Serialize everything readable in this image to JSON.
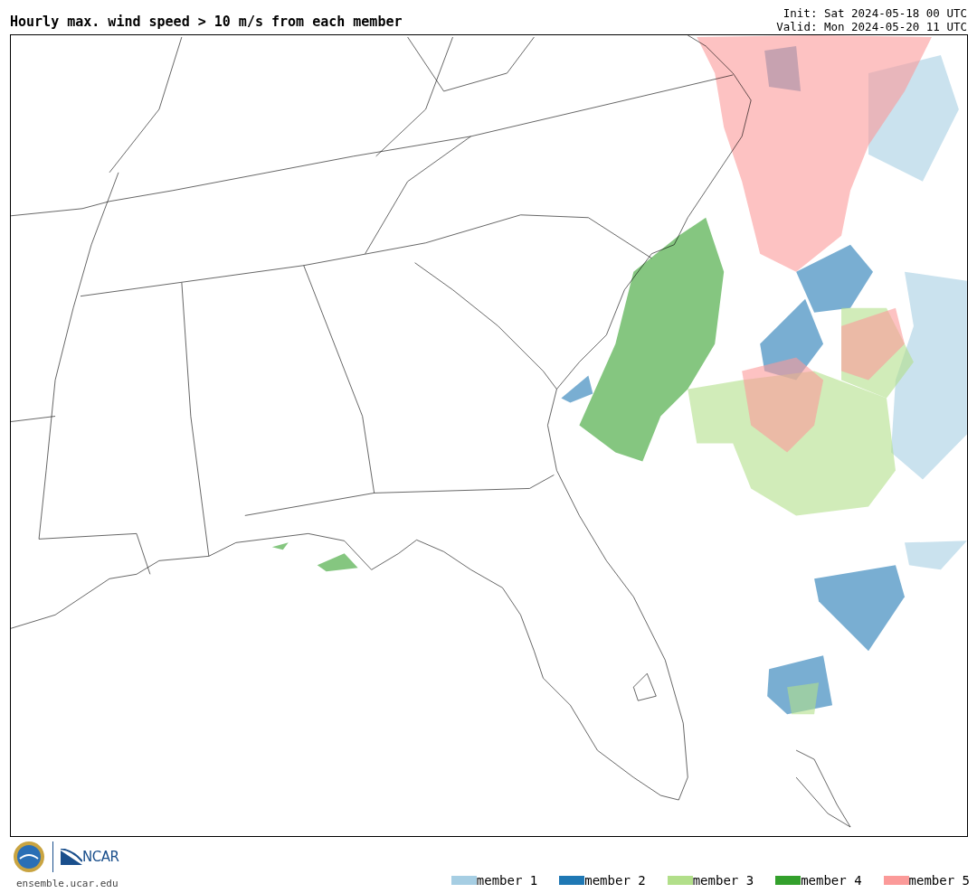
{
  "title": "Hourly max. wind speed > 10 m/s from each member",
  "init": "Init: Sat 2024-05-18 00 UTC",
  "valid": "Valid: Mon 2024-05-20 11 UTC",
  "logo": {
    "text": "NCAR"
  },
  "site": "ensemble.ucar.edu",
  "legend": [
    {
      "label": "member 1",
      "color": "#a6cee3"
    },
    {
      "label": "member 2",
      "color": "#1f78b4"
    },
    {
      "label": "member 3",
      "color": "#b2df8a"
    },
    {
      "label": "member 4",
      "color": "#33a02c"
    },
    {
      "label": "member 5",
      "color": "#fb9a99"
    }
  ]
}
